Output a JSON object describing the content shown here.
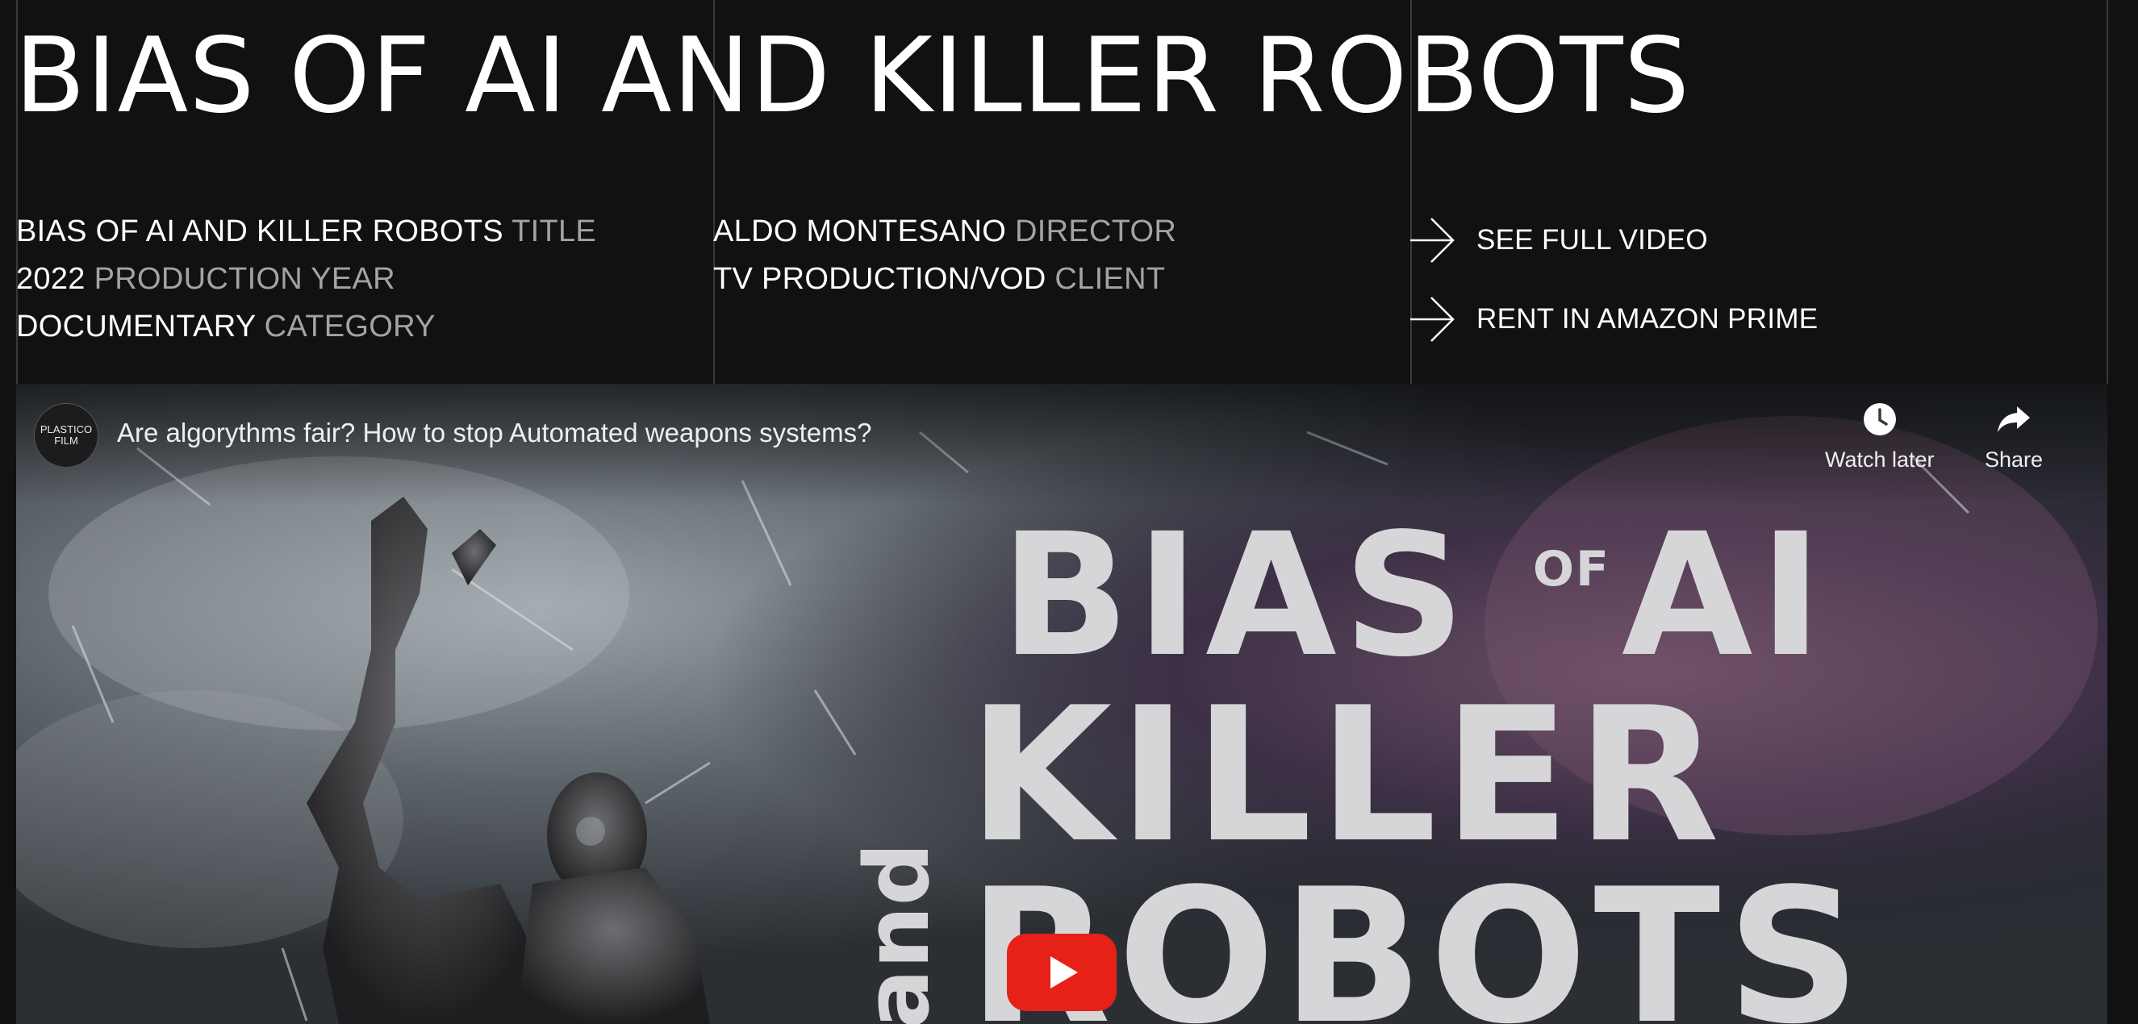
{
  "project": {
    "title": "BIAS OF AI AND KILLER ROBOTS"
  },
  "meta": {
    "left": [
      {
        "value": "BIAS OF AI AND KILLER ROBOTS",
        "key": "TITLE"
      },
      {
        "value": "2022",
        "key": "PRODUCTION YEAR"
      },
      {
        "value": "DOCUMENTARY",
        "key": "CATEGORY"
      }
    ],
    "middle": [
      {
        "value": "ALDO MONTESANO",
        "key": "DIRECTOR"
      },
      {
        "value": "TV PRODUCTION/VOD",
        "key": "CLIENT"
      }
    ]
  },
  "links": {
    "full_video": "SEE FULL VIDEO",
    "amazon": "RENT IN AMAZON PRIME",
    "icon": "arrow-right-icon"
  },
  "video": {
    "channel_name_line1": "PLASTICO",
    "channel_name_line2": "FILM",
    "title": "Are algorythms fair? How to stop Automated weapons systems?",
    "watch_later_label": "Watch later",
    "share_label": "Share",
    "poster": {
      "word_bias": "BIAS",
      "word_of": "OF",
      "word_ai": "AI",
      "word_and": "and",
      "word_killer": "KILLER",
      "word_robots": "ROBOTS"
    },
    "play_button_color": "#e62117"
  },
  "colors": {
    "background": "#111111",
    "text": "#ffffff",
    "muted": "#a3a3a3",
    "grid_line": "#3a3a3a"
  }
}
